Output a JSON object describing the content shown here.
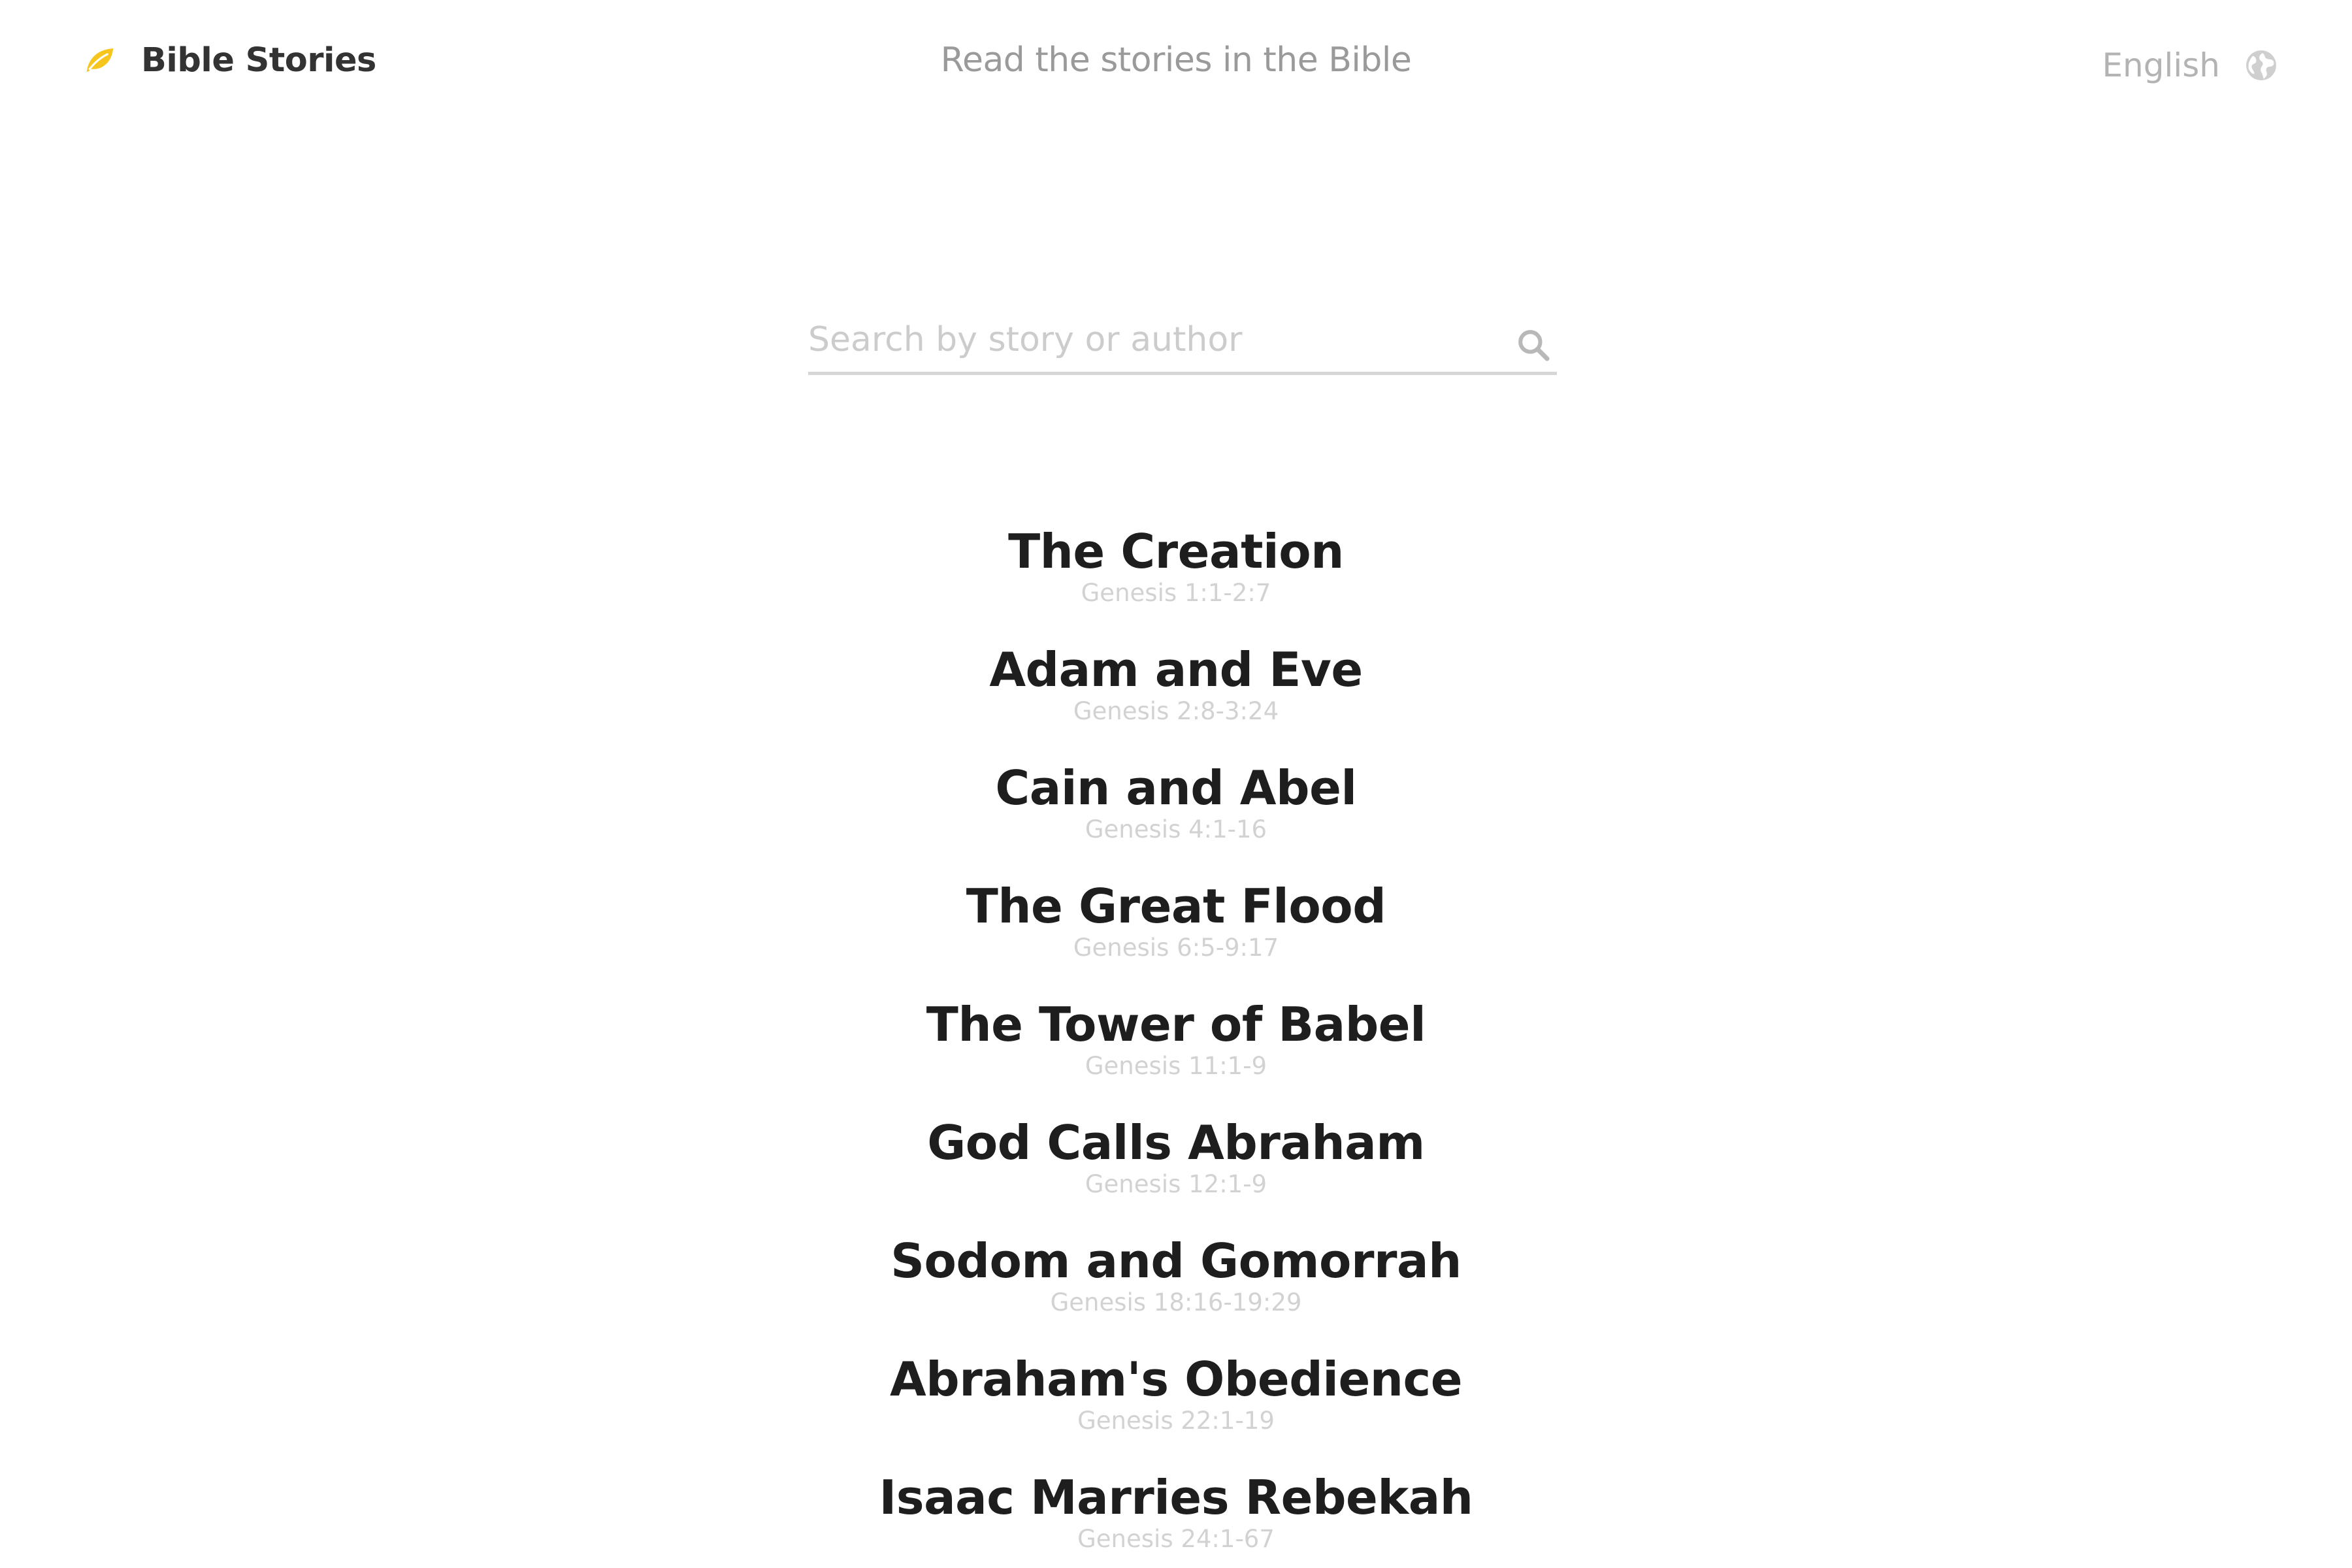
{
  "header": {
    "brand": "Bible Stories",
    "tagline": "Read the stories in the Bible",
    "language": "English",
    "brand_icon": "leaf-icon",
    "language_icon": "globe-icon",
    "accent_color": "#f7c61e"
  },
  "search": {
    "placeholder": "Search by story or author",
    "value": "",
    "icon": "search-icon"
  },
  "stories": [
    {
      "title": "The Creation",
      "reference": "Genesis 1:1-2:7"
    },
    {
      "title": "Adam and Eve",
      "reference": "Genesis 2:8-3:24"
    },
    {
      "title": "Cain and Abel",
      "reference": "Genesis 4:1-16"
    },
    {
      "title": "The Great Flood",
      "reference": "Genesis 6:5-9:17"
    },
    {
      "title": "The Tower of Babel",
      "reference": "Genesis 11:1-9"
    },
    {
      "title": "God Calls Abraham",
      "reference": "Genesis 12:1-9"
    },
    {
      "title": "Sodom and Gomorrah",
      "reference": "Genesis 18:16-19:29"
    },
    {
      "title": "Abraham's Obedience",
      "reference": "Genesis 22:1-19"
    },
    {
      "title": "Isaac Marries Rebekah",
      "reference": "Genesis 24:1-67"
    }
  ]
}
